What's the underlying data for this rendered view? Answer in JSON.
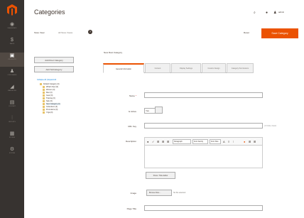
{
  "header": {
    "title": "Categories",
    "user_name": "admin",
    "icons": [
      "search-icon",
      "bell-icon",
      "user-icon"
    ]
  },
  "scope": {
    "label": "Store View:",
    "value": "All Store Views",
    "help_glyph": "?"
  },
  "actions": {
    "reset_label": "Reset",
    "save_label": "Save Category"
  },
  "sidebar": {
    "items": [
      {
        "icon": "dashboard-icon",
        "glyph": "◉",
        "label": "DASHBOARD"
      },
      {
        "icon": "dollar-icon",
        "glyph": "$",
        "label": "SALES"
      },
      {
        "icon": "cube-icon",
        "glyph": "▣",
        "label": "PRODUCTS",
        "active": true
      },
      {
        "icon": "person-icon",
        "glyph": "♟",
        "label": "CUSTOMERS"
      },
      {
        "icon": "megaphone-icon",
        "glyph": "◢",
        "label": "MARKETING"
      },
      {
        "icon": "layout-icon",
        "glyph": "▤",
        "label": "CONTENT"
      },
      {
        "icon": "chart-icon",
        "glyph": "⫶",
        "label": "REPORTS"
      },
      {
        "icon": "store-icon",
        "glyph": "▦",
        "label": "STORES"
      },
      {
        "icon": "gear-icon",
        "glyph": "⚙",
        "label": "SYSTEM"
      }
    ]
  },
  "left_panel": {
    "add_root_label": "Add Root Category",
    "add_sub_label": "Add Subcategory",
    "collapse_all": "Collapse All",
    "expand_all": "Expand All",
    "separator": "|",
    "tree": [
      {
        "label": "Default Category (0)",
        "level": 0
      },
      {
        "label": "What's New (0)",
        "level": 1
      },
      {
        "label": "Women (0)",
        "level": 1
      },
      {
        "label": "Men (0)",
        "level": 1
      },
      {
        "label": "Gear (0)",
        "level": 1
      },
      {
        "label": "Training (0)",
        "level": 1
      },
      {
        "label": "Sale (0)",
        "level": 1
      },
      {
        "label": "New Category (0)",
        "level": 1,
        "selected": true
      },
      {
        "label": "Collections (0)",
        "level": 1
      },
      {
        "label": "Promotions (0)",
        "level": 1
      },
      {
        "label": "Yoga (0)",
        "level": 1
      }
    ]
  },
  "form": {
    "heading": "New Root Category",
    "tabs": [
      "General Information",
      "Content",
      "Display Settings",
      "Custom Design",
      "Category Permissions"
    ],
    "fields": {
      "name_label": "Name",
      "active_label": "Is Active",
      "active_value": "Yes",
      "url_key_label": "URL Key",
      "url_key_hint": "[STORE VIEW]",
      "description_label": "Description",
      "image_label": "Image",
      "browse_label": "Browse Files...",
      "no_file_text": "No file selected.",
      "page_title_label": "Page Title"
    },
    "editor": {
      "paragraph_select": "Paragraph",
      "font_select": "Font Family",
      "size_select": "Font Size",
      "wysiwyg_button": "Show / Hide Editor"
    }
  },
  "colors": {
    "sidebar_bg": "#373330",
    "accent": "#eb5202",
    "link": "#007bdb"
  }
}
